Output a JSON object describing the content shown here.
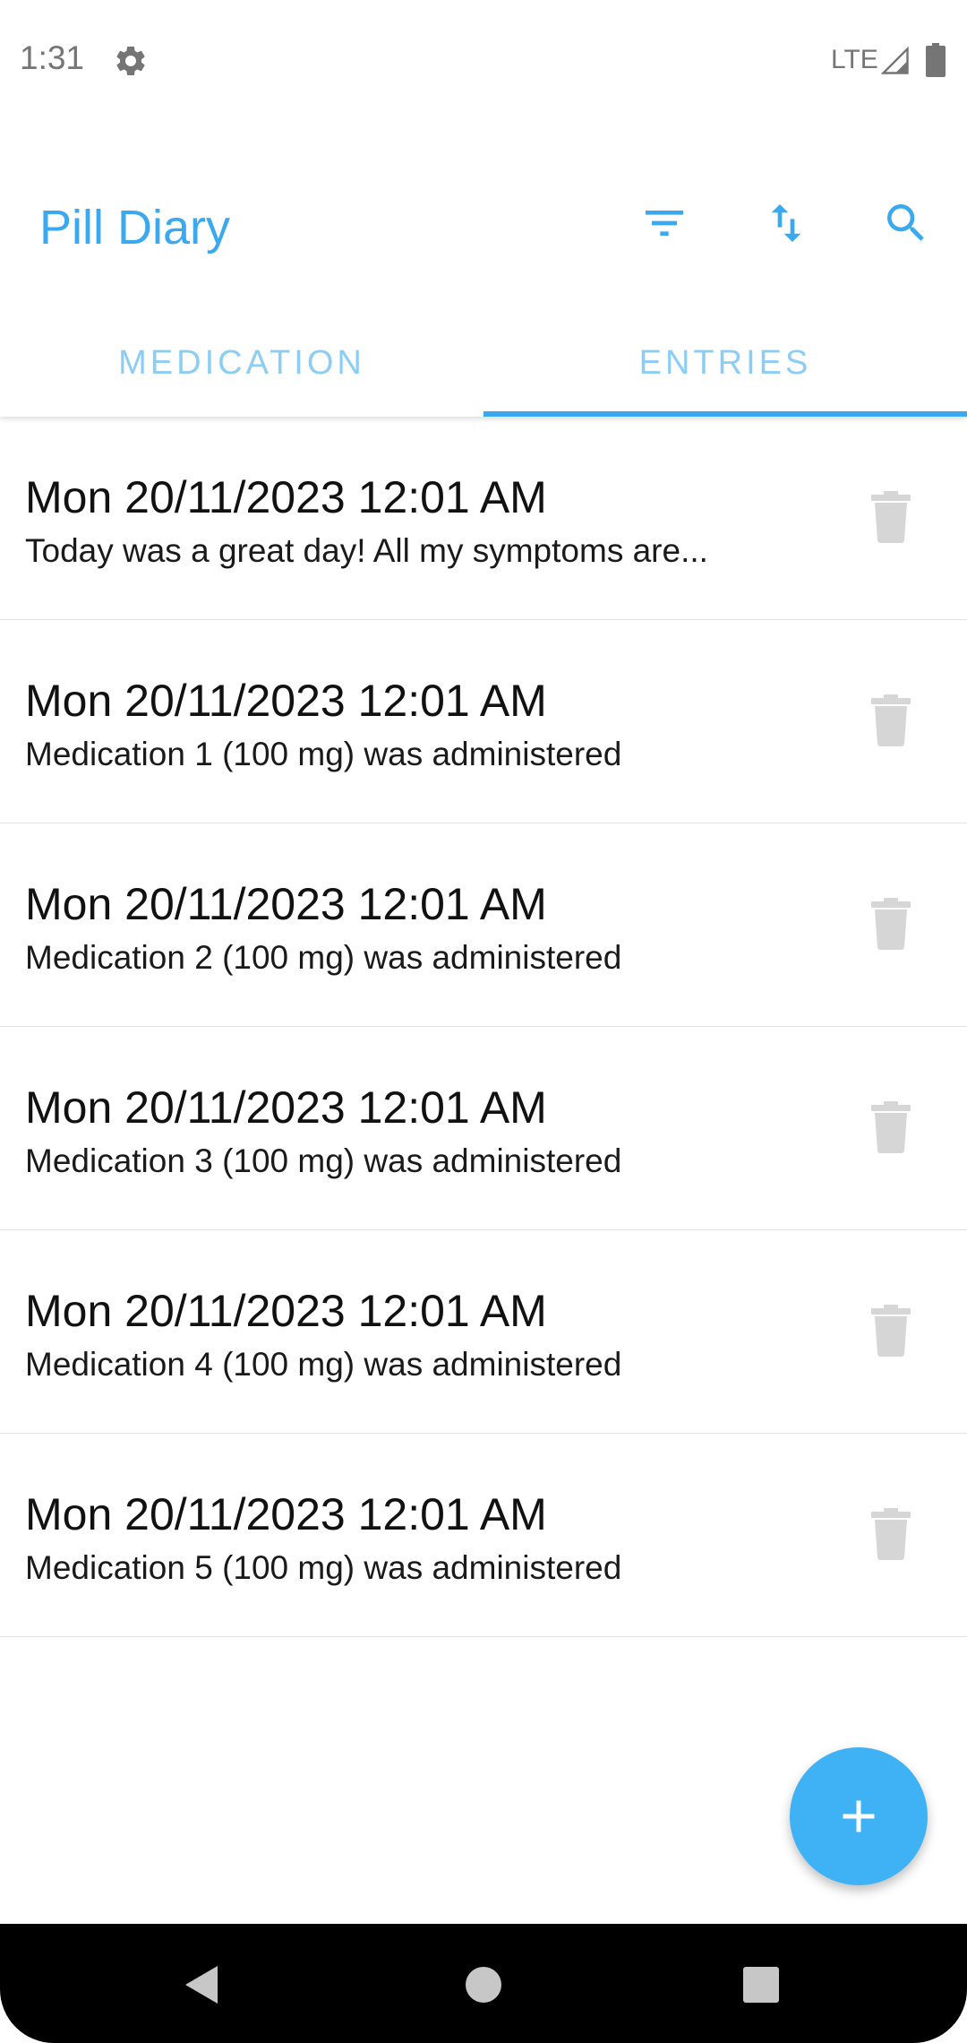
{
  "status_bar": {
    "time": "1:31",
    "network": "LTE",
    "icons": [
      "settings-icon",
      "signal-icon",
      "battery-icon"
    ]
  },
  "app_bar": {
    "title": "Pill Diary",
    "actions": [
      "filter-icon",
      "sort-icon",
      "search-icon"
    ]
  },
  "tabs": [
    {
      "label": "MEDICATION",
      "selected": false
    },
    {
      "label": "ENTRIES",
      "selected": true
    }
  ],
  "entries": [
    {
      "date": "Mon 20/11/2023 12:01 AM",
      "description": "Today was a great day! All my symptoms are..."
    },
    {
      "date": "Mon 20/11/2023 12:01 AM",
      "description": "Medication 1 (100 mg) was administered"
    },
    {
      "date": "Mon 20/11/2023 12:01 AM",
      "description": "Medication 2 (100 mg) was administered"
    },
    {
      "date": "Mon 20/11/2023 12:01 AM",
      "description": "Medication 3 (100 mg) was administered"
    },
    {
      "date": "Mon 20/11/2023 12:01 AM",
      "description": "Medication 4 (100 mg) was administered"
    },
    {
      "date": "Mon 20/11/2023 12:01 AM",
      "description": "Medication 5 (100 mg) was administered"
    }
  ],
  "fab": {
    "icon": "add-icon"
  },
  "nav_bar": {
    "icons": [
      "back-icon",
      "home-icon",
      "recents-icon"
    ]
  },
  "colors": {
    "accent": "#3aa9f0",
    "tab_inactive": "#8ccdf5",
    "fab": "#3fb2f5",
    "delete_icon": "#d6d6d6"
  }
}
